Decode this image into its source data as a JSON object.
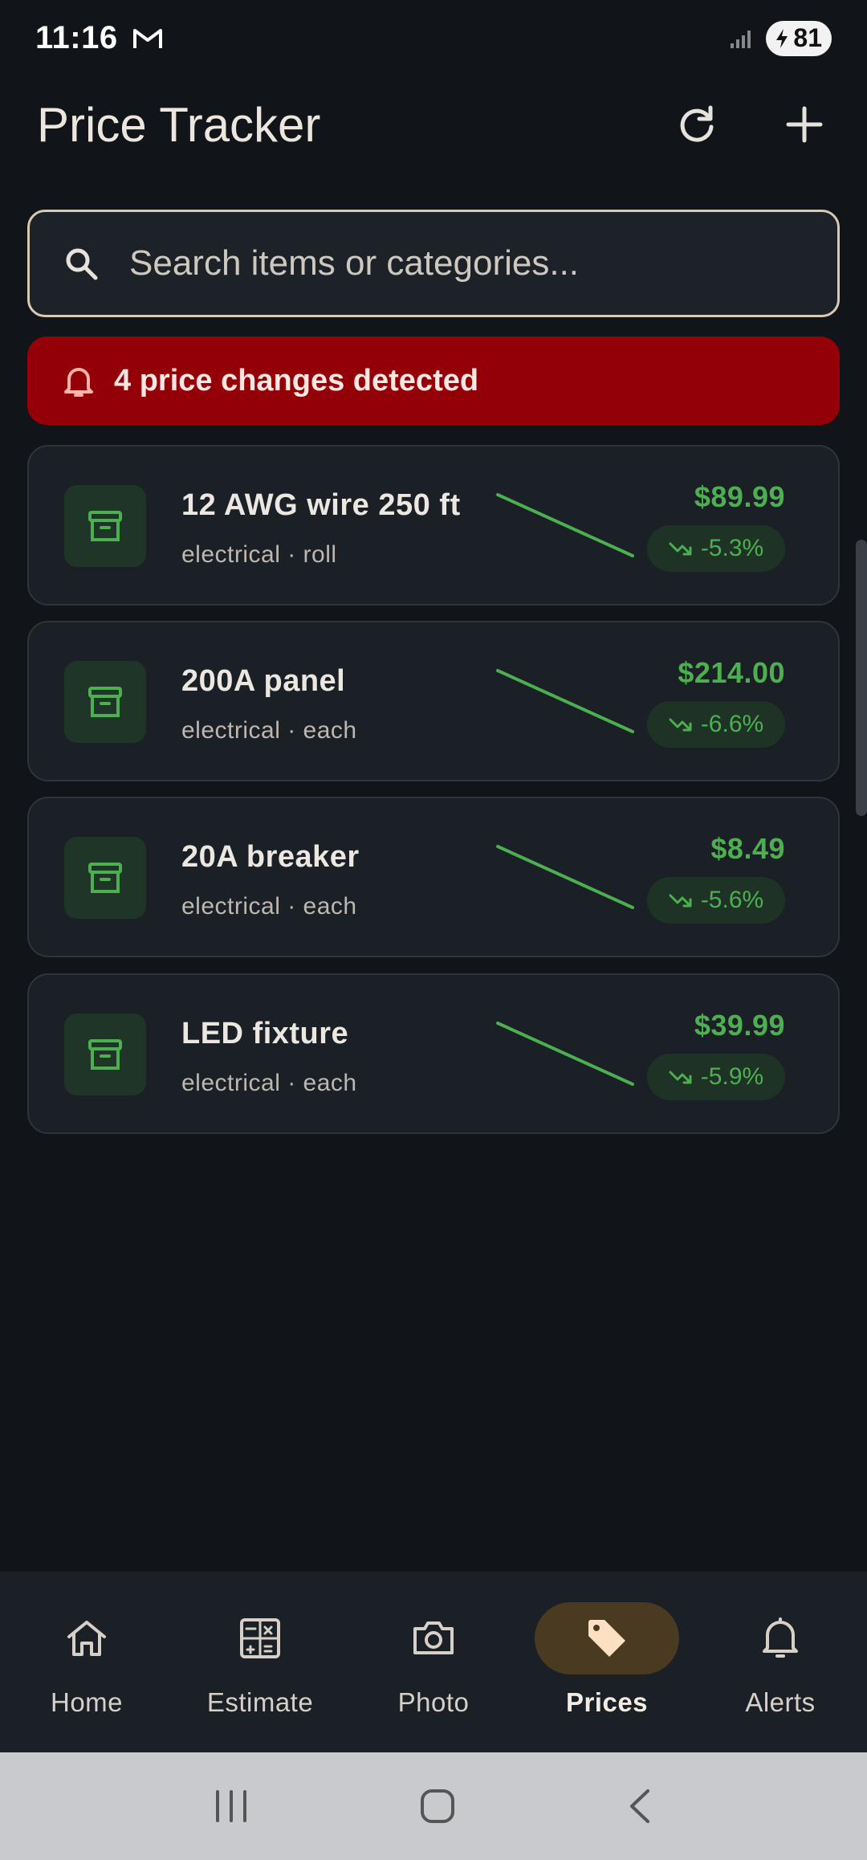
{
  "status_bar": {
    "time": "11:16",
    "battery": "81"
  },
  "app_bar": {
    "title": "Price Tracker",
    "refresh_icon": "refresh-icon",
    "add_icon": "add-icon"
  },
  "search": {
    "placeholder": "Search items or categories..."
  },
  "alert": {
    "text": "4 price changes detected"
  },
  "items": [
    {
      "name": "12 AWG wire 250 ft",
      "meta": "electrical · roll",
      "price": "$89.99",
      "change": "-5.3%",
      "trend": "down"
    },
    {
      "name": "200A panel",
      "meta": "electrical · each",
      "price": "$214.00",
      "change": "-6.6%",
      "trend": "down"
    },
    {
      "name": "20A breaker",
      "meta": "electrical · each",
      "price": "$8.49",
      "change": "-5.6%",
      "trend": "down"
    },
    {
      "name": "LED fixture",
      "meta": "electrical · each",
      "price": "$39.99",
      "change": "-5.9%",
      "trend": "down"
    }
  ],
  "nav": [
    {
      "label": "Home",
      "icon": "home-icon"
    },
    {
      "label": "Estimate",
      "icon": "calculator-icon"
    },
    {
      "label": "Photo",
      "icon": "camera-icon"
    },
    {
      "label": "Prices",
      "icon": "tag-icon",
      "active": true
    },
    {
      "label": "Alerts",
      "icon": "bell-icon"
    }
  ],
  "colors": {
    "background": "#111419",
    "card": "#1b1f26",
    "accent_green": "#4caf50",
    "alert_red": "#930008",
    "active_pill": "#4a3a22"
  }
}
